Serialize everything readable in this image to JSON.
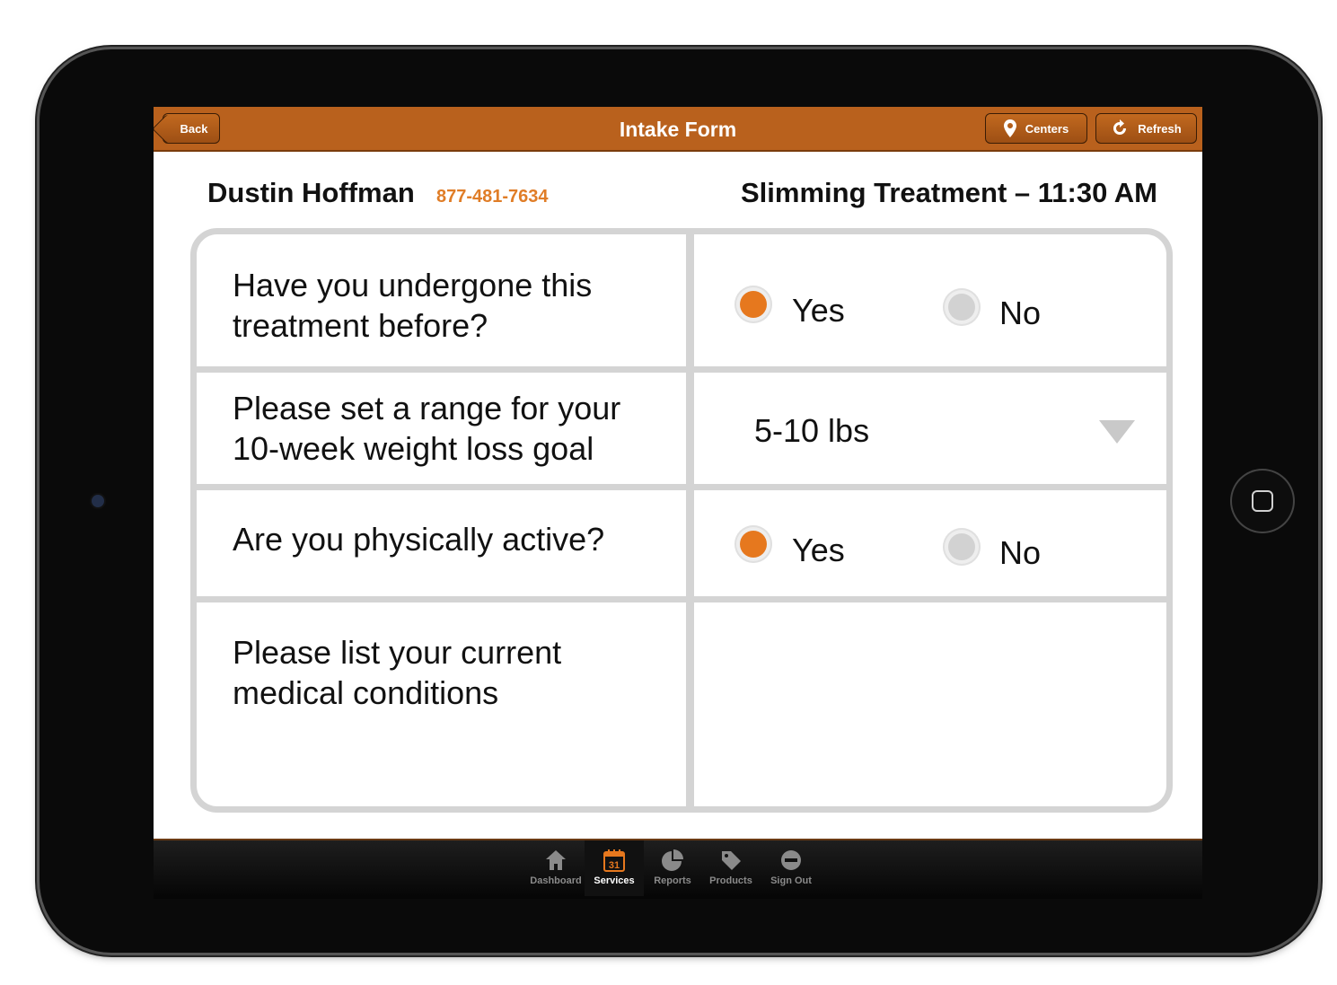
{
  "header": {
    "title": "Intake Form",
    "back_label": "Back",
    "centers_label": "Centers",
    "refresh_label": "Refresh"
  },
  "patient": {
    "name": "Dustin Hoffman",
    "phone": "877-481-7634",
    "appointment": "Slimming Treatment – 11:30 AM"
  },
  "form": {
    "q1": {
      "question": "Have you undergone this treatment before?",
      "yes_label": "Yes",
      "no_label": "No",
      "selected": "Yes"
    },
    "q2": {
      "question": "Please set a range for your 10-week weight loss goal",
      "value": "5-10 lbs"
    },
    "q3": {
      "question": "Are you physically active?",
      "yes_label": "Yes",
      "no_label": "No",
      "selected": "Yes"
    },
    "q4": {
      "question": "Please list your current medical conditions",
      "value": ""
    }
  },
  "tabbar": {
    "items": [
      {
        "label": "Dashboard",
        "icon": "home-icon"
      },
      {
        "label": "Services",
        "icon": "calendar-icon",
        "calendar_day": "31",
        "active": true
      },
      {
        "label": "Reports",
        "icon": "pie-chart-icon"
      },
      {
        "label": "Products",
        "icon": "tag-icon"
      },
      {
        "label": "Sign Out",
        "icon": "minus-circle-icon"
      }
    ]
  },
  "colors": {
    "accent": "#b9611d",
    "radio_selected": "#e6781e",
    "phone_text": "#e07d27"
  }
}
